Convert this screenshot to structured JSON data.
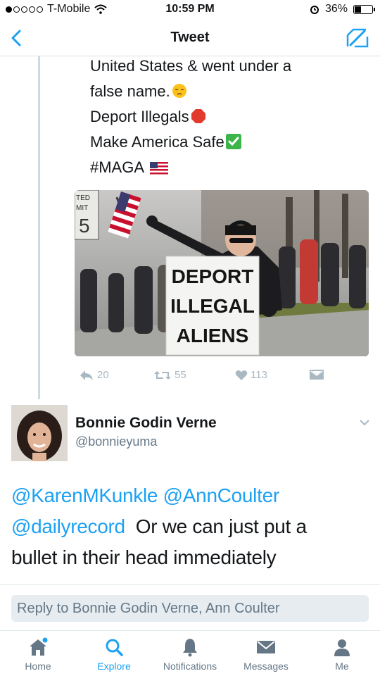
{
  "status_bar": {
    "carrier": "T-Mobile",
    "time": "10:59 PM",
    "battery": "36%",
    "battery_level": 0.36,
    "signal_bars": 1
  },
  "nav": {
    "title": "Tweet"
  },
  "quoted_tweet": {
    "lines": [
      "United States & went under a",
      "false name.",
      "Deport Illegals",
      "Make America Safe",
      "#MAGA"
    ],
    "photo": {
      "sign_lines": [
        "DEPORT",
        "ILLEGAL",
        "ALIENS"
      ],
      "street_sign": [
        "TED",
        "MIT",
        "5"
      ]
    },
    "actions": {
      "replies": "20",
      "retweets": "55",
      "likes": "113"
    }
  },
  "reply_tweet": {
    "name": "Bonnie Godin Verne",
    "handle": "@bonnieyuma",
    "mention_1": "@KarenMKunkle",
    "mention_2": "@AnnCoulter",
    "mention_3": "@dailyrecord",
    "text_1": "Or we can just put a",
    "text_2": "bullet in their head immediately"
  },
  "reply_box": {
    "placeholder": "Reply to Bonnie Godin Verne, Ann Coulter"
  },
  "tabs": [
    {
      "label": "Home",
      "icon": "home-icon"
    },
    {
      "label": "Explore",
      "icon": "search-icon"
    },
    {
      "label": "Notifications",
      "icon": "bell-icon"
    },
    {
      "label": "Messages",
      "icon": "envelope-icon"
    },
    {
      "label": "Me",
      "icon": "person-icon"
    }
  ],
  "colors": {
    "accent": "#1da1f2",
    "muted": "#657786"
  }
}
